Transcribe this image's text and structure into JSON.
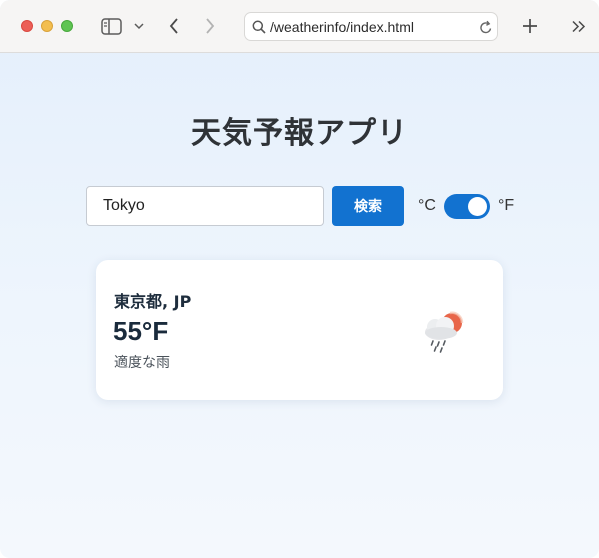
{
  "browser": {
    "url": "/weatherinfo/index.html"
  },
  "app": {
    "title": "天気予報アプリ"
  },
  "search": {
    "value": "Tokyo",
    "button_label": "検索"
  },
  "units": {
    "celsius_label": "°C",
    "fahrenheit_label": "°F",
    "selected": "°F"
  },
  "weather": {
    "city": "東京都, JP",
    "temperature": "55°F",
    "description": "適度な雨",
    "icon": "rain-cloud-sun-icon"
  },
  "colors": {
    "accent": "#1272d0",
    "sun": "#e8664a"
  }
}
